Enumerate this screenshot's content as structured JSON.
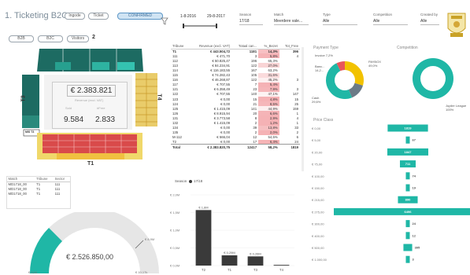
{
  "header": {
    "title": "1. Ticketing B2C",
    "buttons": [
      "Ingode",
      "Ticket",
      "CONFIRMED"
    ],
    "date_from": "1-8-2016",
    "date_to": "29-8-2017",
    "filters": [
      {
        "label": "Season",
        "value": "17/18"
      },
      {
        "label": "Match",
        "value": "Meerdere vale..."
      },
      {
        "label": "Type",
        "value": "Alle"
      },
      {
        "label": "Competition",
        "value": "Alle"
      },
      {
        "label": "Created by",
        "value": "Alle"
      }
    ]
  },
  "stadium": {
    "filter_buttons": [
      "B2B",
      "B2C",
      "Visitors"
    ],
    "side_marker": "2",
    "total_value": "€ 2.383.821",
    "total_label": "Revenue (excl. VAT)",
    "sold_label": "Sold",
    "sold_value": "9.584",
    "free_label": "#Free",
    "free_value": "2.833",
    "stand_labels": [
      "T3",
      "T4",
      "T1"
    ],
    "side_tag": "MIS T3"
  },
  "revenue_table": {
    "columns": [
      "Tribune",
      "Revenue (excl. VAT)",
      "Totaal can...",
      "%_Bezet",
      "Tot_Free"
    ],
    "rows": [
      [
        "T1",
        "€ 443.504,72",
        "1181",
        "14,3%",
        "396"
      ],
      [
        "111",
        "€ 471,70",
        "3",
        "5,8%",
        "4"
      ],
      [
        "112",
        "€ 50.825,47",
        "196",
        "65,3%",
        ""
      ],
      [
        "113",
        "€ 84.234,91",
        "122",
        "27,0%",
        ""
      ],
      [
        "114",
        "€ 116.183,55",
        "167",
        "63,2%",
        ""
      ],
      [
        "115",
        "€ 74.282,43",
        "105",
        "31,6%",
        ""
      ],
      [
        "116",
        "€ 46.268,87",
        "122",
        "45,2%",
        "3"
      ],
      [
        "117",
        "€ 707,55",
        "7",
        "5,4%",
        ""
      ],
      [
        "121",
        "€ 6.358,49",
        "23",
        "7,9%",
        "3"
      ],
      [
        "122",
        "€ 707,55",
        "140",
        "47,1%",
        "147"
      ],
      [
        "123",
        "€ 0,00",
        "15",
        "4,8%",
        "15"
      ],
      [
        "124",
        "€ 0,00",
        "21",
        "8,5%",
        "25"
      ],
      [
        "125",
        "€ 1.415,09",
        "141",
        "44,9%",
        "159"
      ],
      [
        "126",
        "€ 8.915,94",
        "20",
        "6,6%",
        "1"
      ],
      [
        "131",
        "€ 3.773,58",
        "8",
        "2,9%",
        "4"
      ],
      [
        "132",
        "€ 1.415,09",
        "2",
        "1,2%",
        "1"
      ],
      [
        "134",
        "€ 0,00",
        "39",
        "13,8%",
        "33"
      ],
      [
        "135",
        "€ 0,00",
        "2",
        "2,0%",
        "2"
      ],
      [
        "M-112",
        "€ 566,04",
        "12",
        "54,5%",
        "6"
      ],
      [
        "T2",
        "€ 0,00",
        "17",
        "6,4%",
        "24"
      ]
    ],
    "total": [
      "Total",
      "€ 2.383.820,75",
      "12417",
      "58,2%",
      "1819"
    ]
  },
  "small_table": {
    "columns": [
      "Match",
      "Tribune",
      "Sector"
    ],
    "rows": [
      [
        "MD1718_00",
        "T1",
        "111"
      ],
      [
        "MD1718_00",
        "T1",
        "111"
      ],
      [
        "MD1718_00",
        "T1",
        "111"
      ]
    ]
  },
  "gauge": {
    "value_text": "€ 2.526.850,00",
    "min_label": "€ 0,00",
    "max_label": "€ 10,17k",
    "target_label": "€ 8,9M",
    "fraction": 0.25,
    "color": "#1fb7a6"
  },
  "season_chart": {
    "legend_label": "Season",
    "legend_value": "17/18",
    "color": "#3a3a3a",
    "chart_data": {
      "type": "bar",
      "categories": [
        "T2",
        "T1",
        "T3",
        "T4"
      ],
      "values": [
        1.57,
        0.29,
        0.26,
        0.02
      ],
      "data_labels": [
        "€ 1,6M",
        "€ 0,29M",
        "€ 0,26M",
        ""
      ],
      "ytick_labels": [
        "€ 2,0M",
        "€ 1,5M",
        "€ 1,0M",
        "€ 0,5M",
        "€ 0,0M"
      ],
      "ylim": [
        0,
        2.0
      ]
    }
  },
  "payment_type": {
    "title": "Payment Type",
    "chart_data": {
      "type": "pie",
      "labels": [
        "Cash",
        "Banc...",
        "PAYBOX",
        "Invoice"
      ],
      "values": [
        29.6,
        14.2,
        49.0,
        7.2
      ],
      "colors": [
        "#f2c200",
        "#6c7b87",
        "#1fb7a6",
        "#e8555b"
      ],
      "slice_labels": [
        "Cash\n29,6%",
        "Banc...\n14,2...",
        "PAYBOX\n49,0%",
        "Invoice 7,2%"
      ]
    }
  },
  "competition": {
    "title": "Competition",
    "chart_data": {
      "type": "pie",
      "labels": [
        "Jupiler League"
      ],
      "values": [
        100
      ],
      "colors": [
        "#1fb7a6"
      ],
      "slice_labels": [
        "Jupiler League\n100%"
      ]
    }
  },
  "price_class": {
    "title": "Price Class",
    "color": "#1fb7a6",
    "chart_data": {
      "type": "bar",
      "orientation": "horizontal-funnel",
      "categories": [
        "€ 0,00",
        "€ 5,00",
        "€ 20,00",
        "€ 75,00",
        "€ 100,00",
        "€ 150,00",
        "€ 215,00",
        "€ 275,00",
        "€ 300,00",
        "€ 400,00",
        "€ 500,00",
        "€ 1.000,00"
      ],
      "values": [
        1819,
        67,
        1847,
        711,
        74,
        19,
        890,
        6496,
        24,
        12,
        395,
        3
      ],
      "labels": [
        "1819",
        "67",
        "1847",
        "711",
        "74",
        "19",
        "890",
        "6496",
        "24",
        "12",
        "395",
        "3"
      ]
    }
  }
}
